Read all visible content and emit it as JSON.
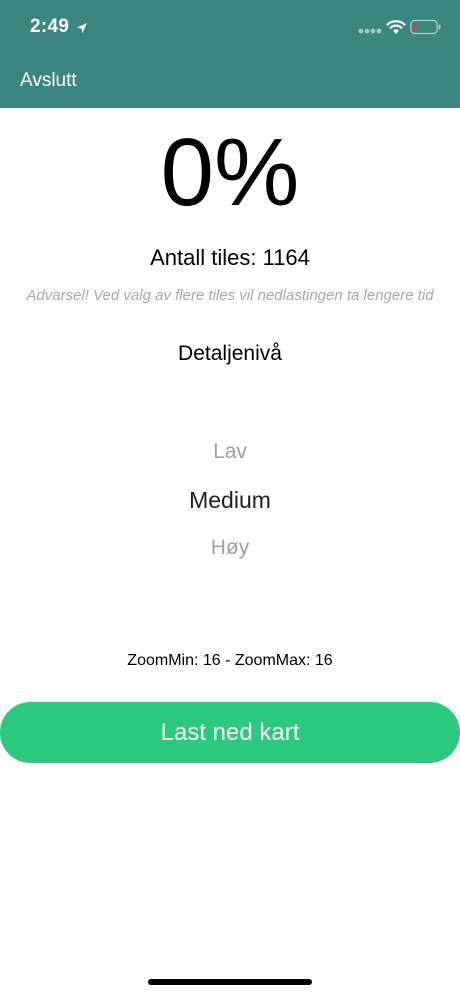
{
  "status_bar": {
    "time": "2:49",
    "location_icon": "location-arrow-icon",
    "wifi_icon": "wifi-icon",
    "battery_icon": "battery-low-icon",
    "battery_level": 0.1,
    "battery_color": "#e53935"
  },
  "header": {
    "back_label": "Avslutt",
    "background_color": "#3c8680"
  },
  "download": {
    "percent": "0%",
    "tiles_count": "Antall tiles: 1164",
    "warning": "Advarsel! Ved valg av flere tiles vil nedlastingen ta lengere tid",
    "detail_label": "Detaljenivå",
    "detail_options": [
      "Lav",
      "Medium",
      "Høy"
    ],
    "selected_option": "Medium",
    "zoom_info": "ZoomMin: 16 - ZoomMax: 16",
    "button_label": "Last ned kart",
    "button_color": "#2ac97e"
  }
}
